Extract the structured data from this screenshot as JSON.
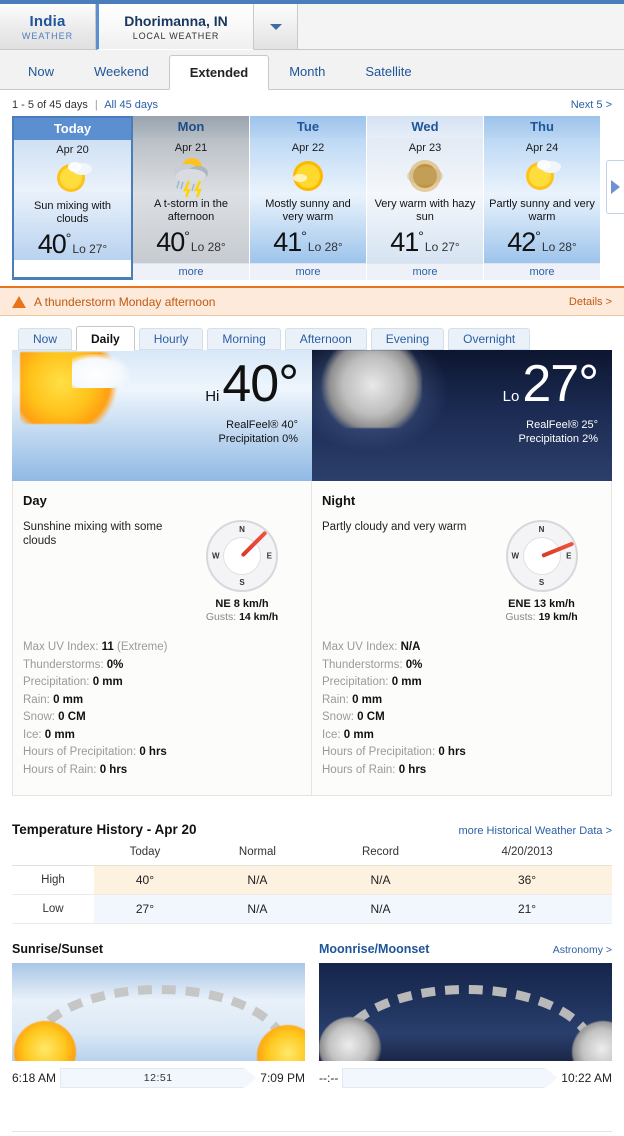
{
  "colors": {
    "accent_blue": "#4a7ebb",
    "link_blue": "#2a5fa5",
    "alert_orange": "#e8731c",
    "alert_bg": "#fdeadb",
    "high_row_bg": "#fdf1e0",
    "low_row_bg": "#f2f6fd"
  },
  "location_bar": {
    "country_tab": {
      "title": "India",
      "subtitle": "WEATHER"
    },
    "city_tab": {
      "title": "Dhorimanna, IN",
      "subtitle": "LOCAL WEATHER"
    },
    "dropdown_icon": "chevron-down-icon"
  },
  "nav": {
    "tabs": [
      {
        "label": "Now",
        "active": false
      },
      {
        "label": "Weekend",
        "active": false
      },
      {
        "label": "Extended",
        "active": true
      },
      {
        "label": "Month",
        "active": false
      },
      {
        "label": "Satellite",
        "active": false
      }
    ]
  },
  "pager": {
    "range_text": "1 - 5 of 45 days",
    "separator": "|",
    "all_days_link": "All 45 days",
    "next_link": "Next 5 >"
  },
  "forecast": {
    "next_arrow_icon": "chevron-right-icon",
    "more_label": "more",
    "cards": [
      {
        "day": "Today",
        "date": "Apr 20",
        "icon": "sun-behind-cloud-icon",
        "description": "Sun mixing with clouds",
        "high": "40",
        "low": "Lo 27°",
        "theme": "today",
        "selected": true
      },
      {
        "day": "Mon",
        "date": "Apr 21",
        "icon": "thunderstorm-icon",
        "description": "A t-storm in the afternoon",
        "high": "40",
        "low": "Lo 28°",
        "theme": "gray",
        "selected": false
      },
      {
        "day": "Tue",
        "date": "Apr 22",
        "icon": "mostly-sunny-icon",
        "description": "Mostly sunny and very warm",
        "high": "41",
        "low": "Lo 28°",
        "theme": "blue",
        "selected": false
      },
      {
        "day": "Wed",
        "date": "Apr 23",
        "icon": "hazy-sun-icon",
        "description": "Very warm with hazy sun",
        "high": "41",
        "low": "Lo 27°",
        "theme": "pale",
        "selected": false
      },
      {
        "day": "Thu",
        "date": "Apr 24",
        "icon": "partly-sunny-icon",
        "description": "Partly sunny and very warm",
        "high": "42",
        "low": "Lo 28°",
        "theme": "blue",
        "selected": false
      }
    ]
  },
  "alert": {
    "icon": "warning-triangle-icon",
    "message": "A thunderstorm Monday afternoon",
    "details_link": "Details >"
  },
  "sub_tabs": [
    {
      "label": "Now",
      "active": false
    },
    {
      "label": "Daily",
      "active": true
    },
    {
      "label": "Hourly",
      "active": false
    },
    {
      "label": "Morning",
      "active": false
    },
    {
      "label": "Afternoon",
      "active": false
    },
    {
      "label": "Evening",
      "active": false
    },
    {
      "label": "Overnight",
      "active": false
    }
  ],
  "hero": {
    "day": {
      "icon": "sun-behind-cloud-icon",
      "label": "Hi",
      "temp": "40°",
      "realfeel": "RealFeel® 40°",
      "precipitation": "Precipitation 0%"
    },
    "night": {
      "icon": "moon-behind-cloud-icon",
      "label": "Lo",
      "temp": "27°",
      "realfeel": "RealFeel® 25°",
      "precipitation": "Precipitation 2%"
    }
  },
  "detail_panels": {
    "day": {
      "title": "Day",
      "description": "Sunshine mixing with some clouds",
      "compass_icon": "compass-icon",
      "compass": {
        "n": "N",
        "e": "E",
        "s": "S",
        "w": "W",
        "needle_deg": 45
      },
      "wind": "NE 8 km/h",
      "gusts_label": "Gusts:",
      "gusts_value": "14 km/h",
      "stats": [
        {
          "label": "Max UV Index:",
          "value": "11",
          "note": "(Extreme)"
        },
        {
          "label": "Thunderstorms:",
          "value": "0%",
          "note": ""
        },
        {
          "label": "Precipitation:",
          "value": "0 mm",
          "note": ""
        },
        {
          "label": "Rain:",
          "value": "0 mm",
          "note": ""
        },
        {
          "label": "Snow:",
          "value": "0 CM",
          "note": ""
        },
        {
          "label": "Ice:",
          "value": "0 mm",
          "note": ""
        },
        {
          "label": "Hours of Precipitation:",
          "value": "0 hrs",
          "note": ""
        },
        {
          "label": "Hours of Rain:",
          "value": "0 hrs",
          "note": ""
        }
      ]
    },
    "night": {
      "title": "Night",
      "description": "Partly cloudy and very warm",
      "compass_icon": "compass-icon",
      "compass": {
        "n": "N",
        "e": "E",
        "s": "S",
        "w": "W",
        "needle_deg": 68
      },
      "wind": "ENE 13 km/h",
      "gusts_label": "Gusts:",
      "gusts_value": "19 km/h",
      "stats": [
        {
          "label": "Max UV Index:",
          "value": "N/A",
          "note": ""
        },
        {
          "label": "Thunderstorms:",
          "value": "0%",
          "note": ""
        },
        {
          "label": "Precipitation:",
          "value": "0 mm",
          "note": ""
        },
        {
          "label": "Rain:",
          "value": "0 mm",
          "note": ""
        },
        {
          "label": "Snow:",
          "value": "0 CM",
          "note": ""
        },
        {
          "label": "Ice:",
          "value": "0 mm",
          "note": ""
        },
        {
          "label": "Hours of Precipitation:",
          "value": "0 hrs",
          "note": ""
        },
        {
          "label": "Hours of Rain:",
          "value": "0 hrs",
          "note": ""
        }
      ]
    }
  },
  "temperature_history": {
    "title": "Temperature History - Apr 20",
    "more_link": "more Historical Weather Data >",
    "columns": [
      "",
      "Today",
      "Normal",
      "Record",
      "4/20/2013"
    ],
    "rows": [
      {
        "label": "High",
        "values": [
          "40°",
          "N/A",
          "N/A",
          "36°"
        ]
      },
      {
        "label": "Low",
        "values": [
          "27°",
          "N/A",
          "N/A",
          "21°"
        ]
      }
    ]
  },
  "sun_moon": {
    "sunrise_sunset": {
      "title": "Sunrise/Sunset",
      "rise": "6:18 AM",
      "duration": "12:51",
      "set": "7:09 PM",
      "rise_icon": "sun-icon",
      "set_icon": "sun-icon"
    },
    "moonrise_moonset": {
      "title": "Moonrise/Moonset",
      "astronomy_link": "Astronomy >",
      "rise": "--:--",
      "duration": "",
      "set": "10:22 AM",
      "rise_icon": "moon-icon",
      "set_icon": "moon-icon"
    }
  }
}
